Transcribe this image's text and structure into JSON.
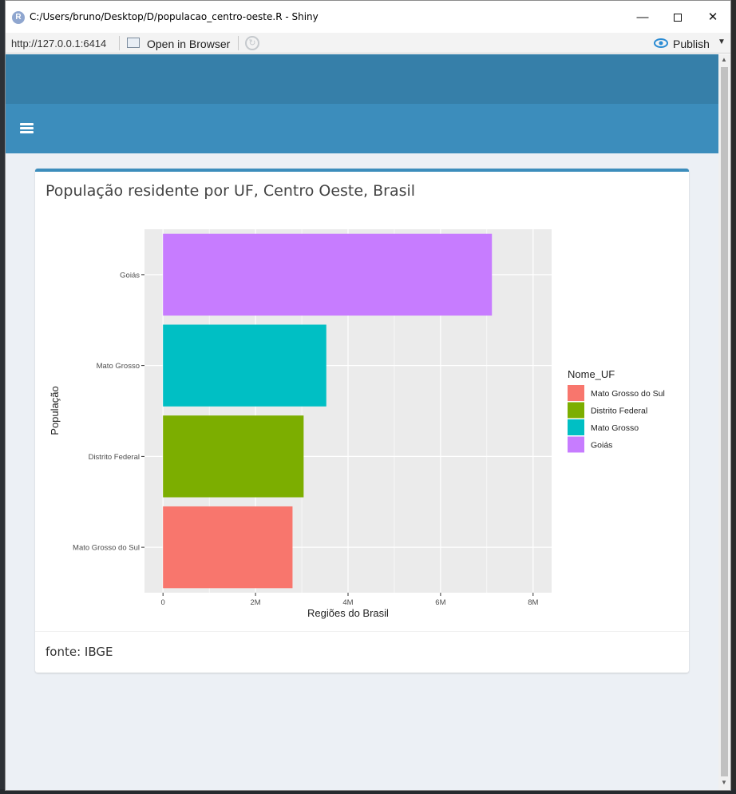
{
  "window": {
    "title": "C:/Users/bruno/Desktop/D/populacao_centro-oeste.R - Shiny",
    "url": "http://127.0.0.1:6414",
    "open_in_browser": "Open in Browser",
    "publish": "Publish"
  },
  "box": {
    "title": "População residente por UF, Centro Oeste, Brasil",
    "footer": "fonte: IBGE"
  },
  "chart_data": {
    "type": "bar",
    "orientation": "horizontal",
    "categories": [
      "Mato Grosso do Sul",
      "Distrito Federal",
      "Mato Grosso",
      "Goiás"
    ],
    "values": [
      2800000,
      3040000,
      3530000,
      7110000
    ],
    "colors": [
      "#F8766D",
      "#7CAE00",
      "#00BFC4",
      "#C77CFF"
    ],
    "xlabel": "Regiões do Brasil",
    "ylabel": "População",
    "xlim": [
      -400000,
      8400000
    ],
    "x_ticks": [
      0,
      2000000,
      4000000,
      6000000,
      8000000
    ],
    "x_tick_labels": [
      "0",
      "2M",
      "4M",
      "6M",
      "8M"
    ],
    "legend_title": "Nome_UF",
    "legend_entries": [
      "Mato Grosso do Sul",
      "Distrito Federal",
      "Mato Grosso",
      "Goiás"
    ],
    "legend_position": "right",
    "grid": true,
    "panel_background": "#EBEBEB"
  }
}
